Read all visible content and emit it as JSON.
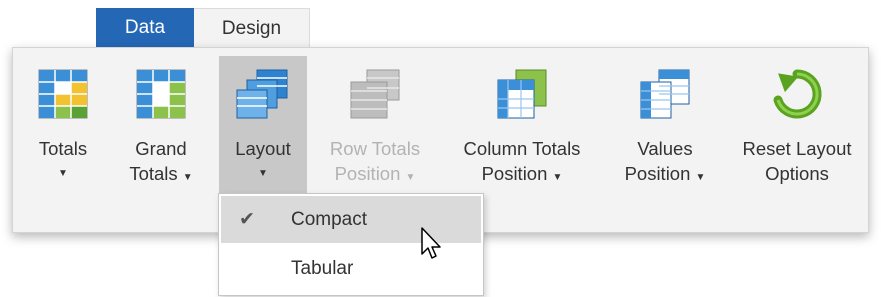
{
  "tabs": [
    {
      "label": "Data",
      "active": false
    },
    {
      "label": "Design",
      "active": true
    }
  ],
  "ribbon": {
    "buttons": [
      {
        "line1": "Totals",
        "line2": "",
        "has_dropdown": true,
        "icon": "totals-icon"
      },
      {
        "line1": "Grand",
        "line2": "Totals",
        "has_dropdown": true,
        "icon": "grand-totals-icon"
      },
      {
        "line1": "Layout",
        "line2": "",
        "has_dropdown": true,
        "icon": "layout-icon",
        "state": "pressed"
      },
      {
        "line1": "Row Totals",
        "line2": "Position",
        "has_dropdown": true,
        "icon": "row-totals-position-icon",
        "state": "disabled"
      },
      {
        "line1": "Column Totals",
        "line2": "Position",
        "has_dropdown": true,
        "icon": "column-totals-position-icon"
      },
      {
        "line1": "Values",
        "line2": "Position",
        "has_dropdown": true,
        "icon": "values-position-icon"
      },
      {
        "line1": "Reset Layout",
        "line2": "Options",
        "has_dropdown": false,
        "icon": "reset-layout-icon"
      }
    ],
    "dropdown_glyph": "▼"
  },
  "layout_menu": {
    "items": [
      {
        "label": "Compact",
        "checked": true,
        "highlighted": true
      },
      {
        "label": "Tabular",
        "checked": false,
        "highlighted": false
      }
    ],
    "check_glyph": "✔"
  },
  "colors": {
    "accent_tab": "#2467b5",
    "ribbon_bg": "#f3f3f3",
    "pressed_bg": "#c8c8c8",
    "menu_highlight": "#dadada",
    "disabled_text": "#b3b3b3",
    "reset_icon_green": "#5aa321"
  }
}
